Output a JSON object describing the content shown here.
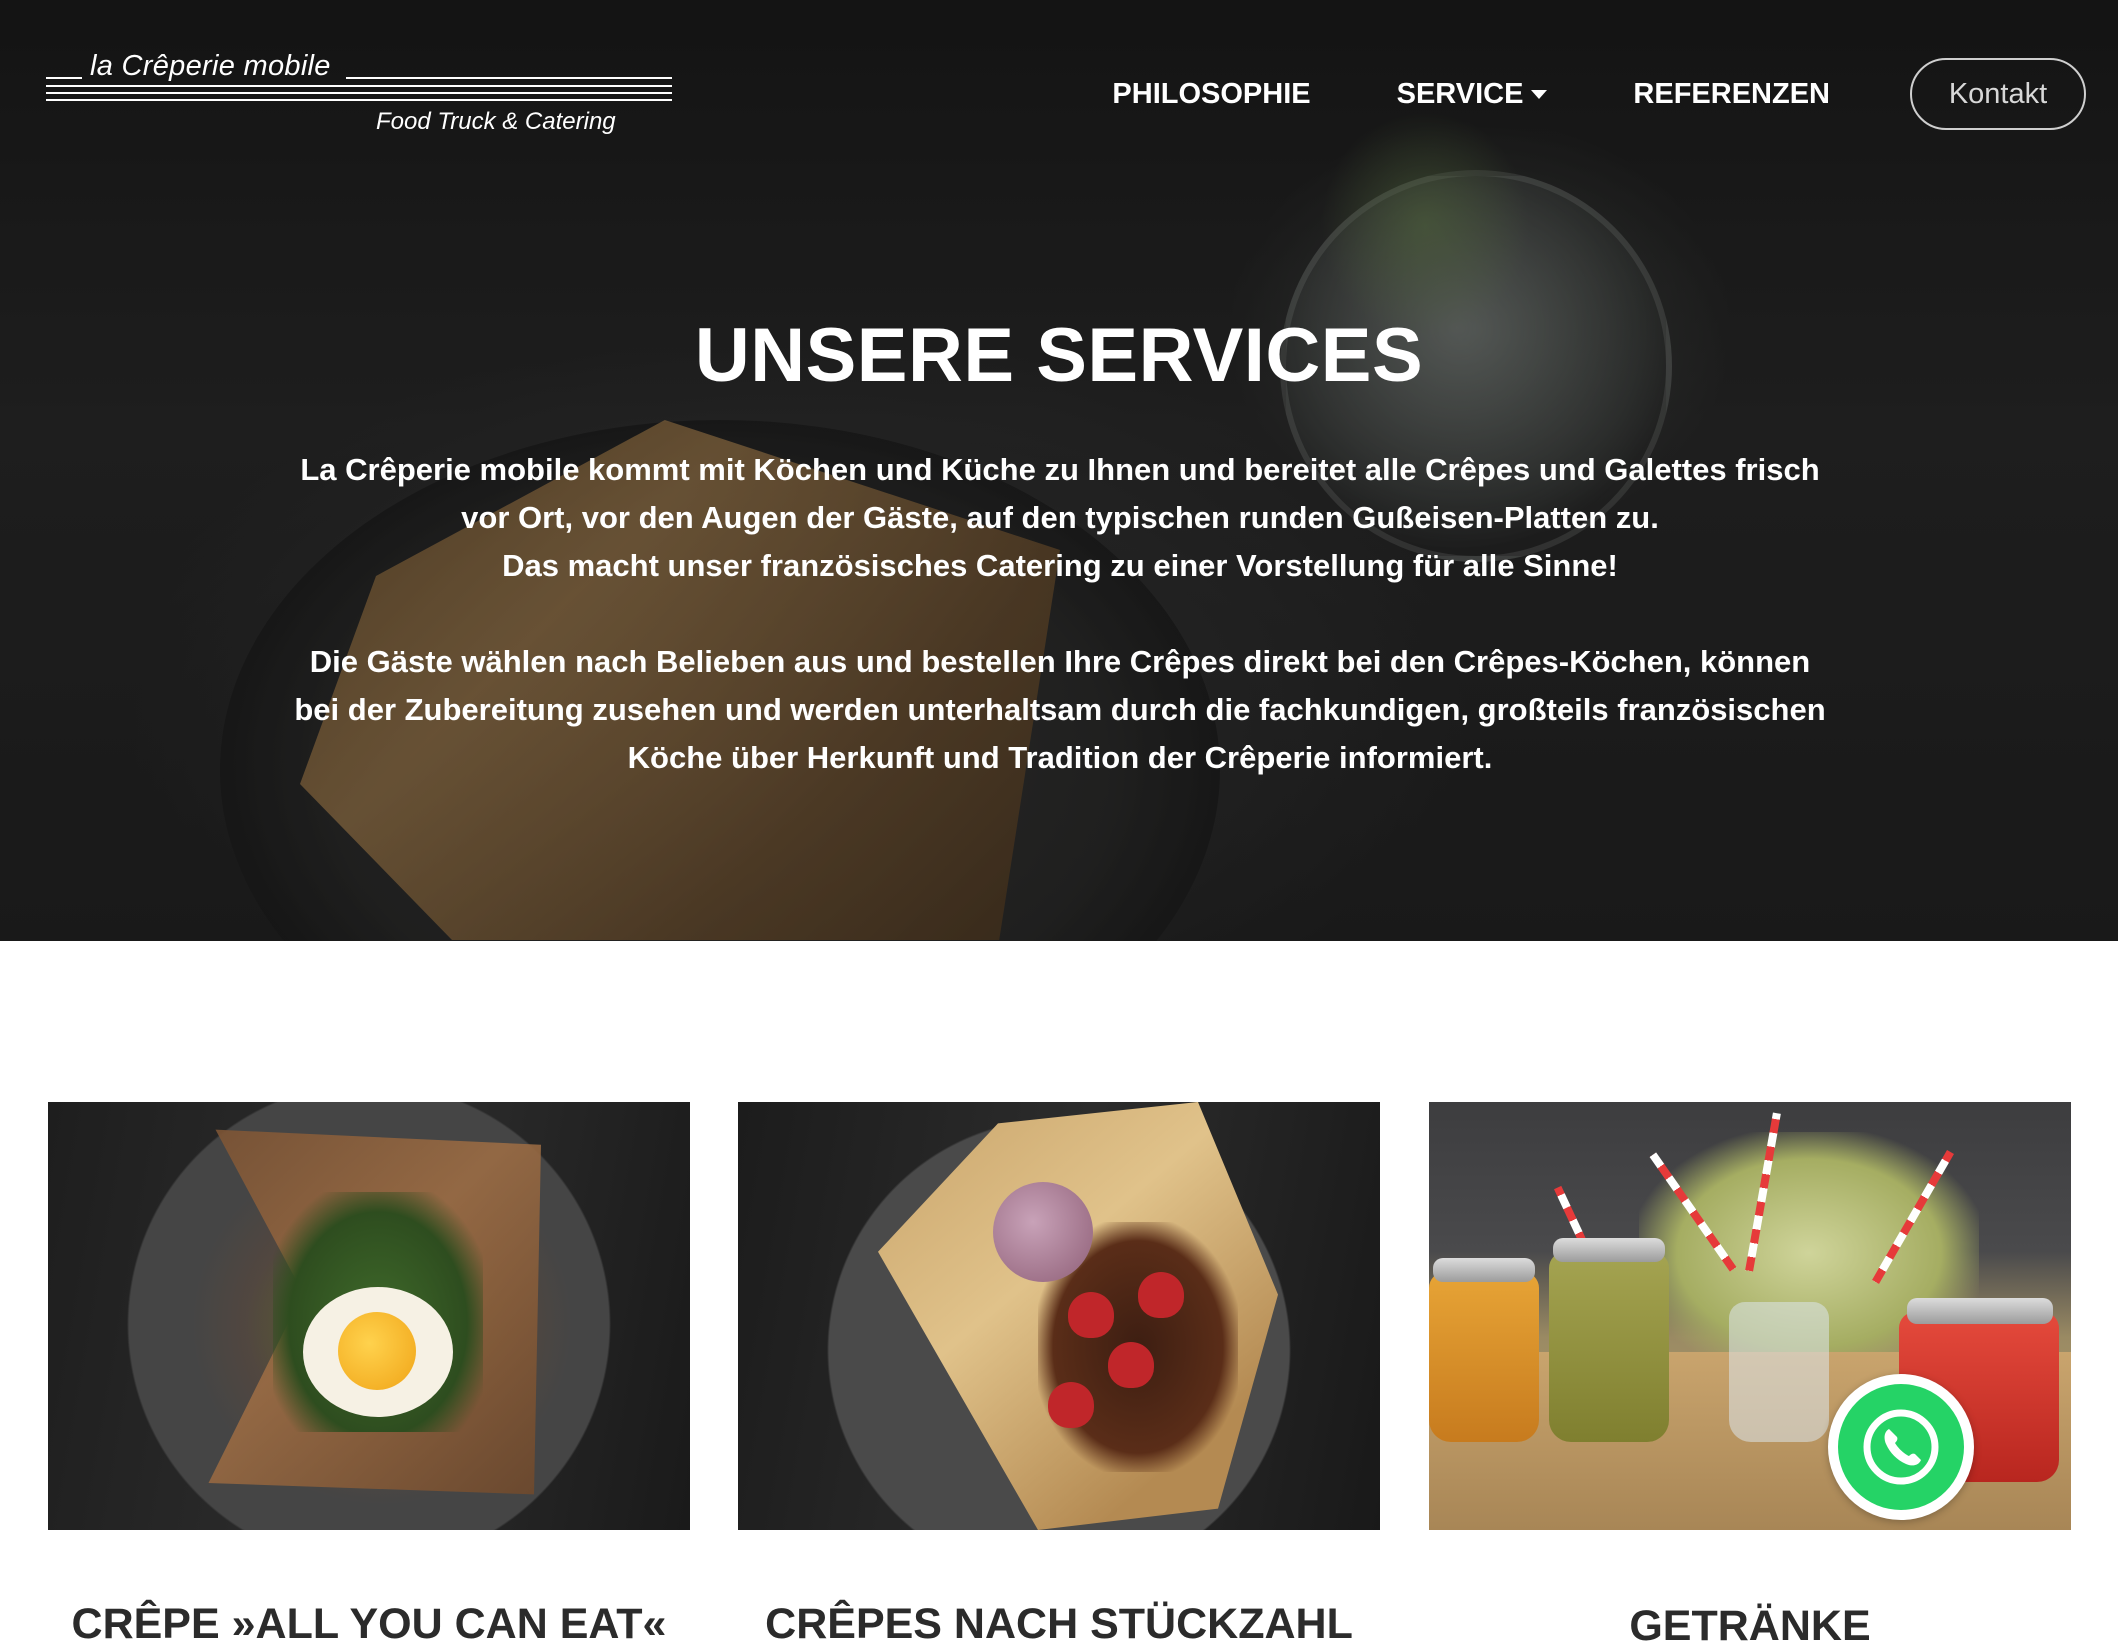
{
  "logo": {
    "title": "la Crêperie mobile",
    "subtitle": "Food Truck & Catering"
  },
  "nav": {
    "items": [
      {
        "label": "PHILOSOPHIE"
      },
      {
        "label": "SERVICE"
      },
      {
        "label": "REFERENZEN"
      }
    ],
    "contact_label": "Kontakt"
  },
  "hero": {
    "title": "UNSERE SERVICES",
    "paragraph1": [
      "La Crêperie mobile kommt mit Köchen und Küche zu Ihnen und bereitet alle Crêpes und Galettes frisch",
      "vor Ort, vor den Augen der Gäste, auf den typischen runden Gußeisen-Platten zu.",
      "Das macht unser französisches Catering zu einer Vorstellung für alle Sinne!"
    ],
    "paragraph2": [
      "Die Gäste wählen nach Belieben aus und bestellen Ihre Crêpes direkt bei den Crêpes-Köchen, können",
      "bei der Zubereitung zusehen und werden unterhaltsam durch die fachkundigen, großteils französischen",
      "Köche über Herkunft und Tradition der Crêperie informiert."
    ]
  },
  "services": [
    {
      "title": "CRÊPE »ALL YOU CAN EAT«"
    },
    {
      "title": "CRÊPES NACH STÜCKZAHL"
    },
    {
      "title": "GETRÄNKE"
    }
  ],
  "icons": {
    "nav_dropdown": "caret-down-icon",
    "chat": "whatsapp-icon"
  },
  "colors": {
    "whatsapp_green": "#25d366",
    "heading_dark": "#2b2b2b"
  }
}
